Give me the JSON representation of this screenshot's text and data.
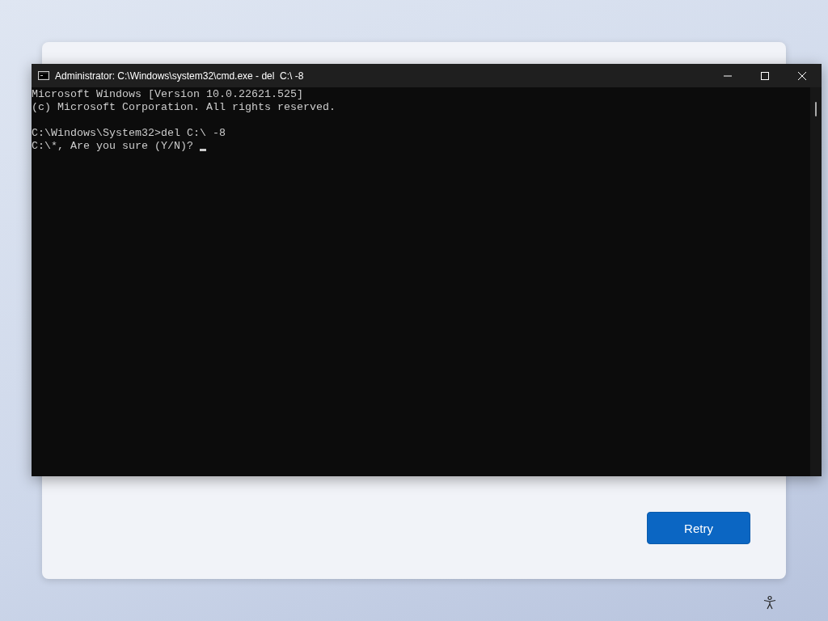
{
  "console_window": {
    "title": "Administrator: C:\\Windows\\system32\\cmd.exe - del  C:\\ -8",
    "blocks": [
      [
        "Microsoft Windows [Version 10.0.22621.525]",
        "(c) Microsoft Corporation. All rights reserved."
      ],
      [
        "C:\\Windows\\System32>del C:\\ -8",
        "C:\\*, Are you sure (Y/N)? "
      ]
    ]
  },
  "dialog": {
    "buttons": [
      {
        "label": "Retry"
      }
    ]
  }
}
